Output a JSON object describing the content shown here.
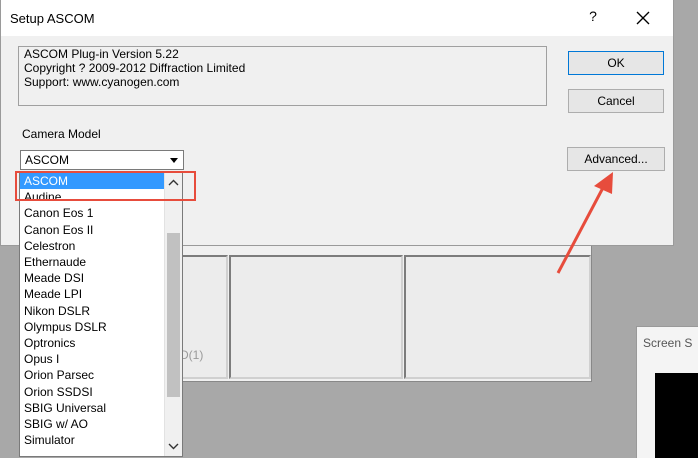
{
  "dialog": {
    "title": "Setup ASCOM",
    "help_label": "?",
    "info_lines": [
      "ASCOM Plug-in Version 5.22",
      "Copyright ? 2009-2012 Diffraction Limited",
      "Support: www.cyanogen.com"
    ],
    "ok_label": "OK",
    "cancel_label": "Cancel",
    "advanced_label": "Advanced...",
    "camera_model_label": "Camera Model",
    "camera_model_value": "ASCOM"
  },
  "dropdown": {
    "items": [
      "ASCOM",
      "Audine",
      "Canon Eos 1",
      "Canon Eos II",
      "Celestron",
      "Ethernaude",
      "Meade DSI",
      "Meade LPI",
      "Nikon DSLR",
      "Olympus DSLR",
      "Optronics",
      "Opus I",
      "Orion Parsec",
      "Orion SSDSI",
      "SBIG Universal",
      "SBIG w/ AO",
      "Simulator"
    ],
    "selected": "ASCOM"
  },
  "background": {
    "partial_label": "D(1)",
    "screen_window_title": "Screen S"
  },
  "colors": {
    "selection": "#3399ff",
    "annotation": "#e74c3c"
  }
}
